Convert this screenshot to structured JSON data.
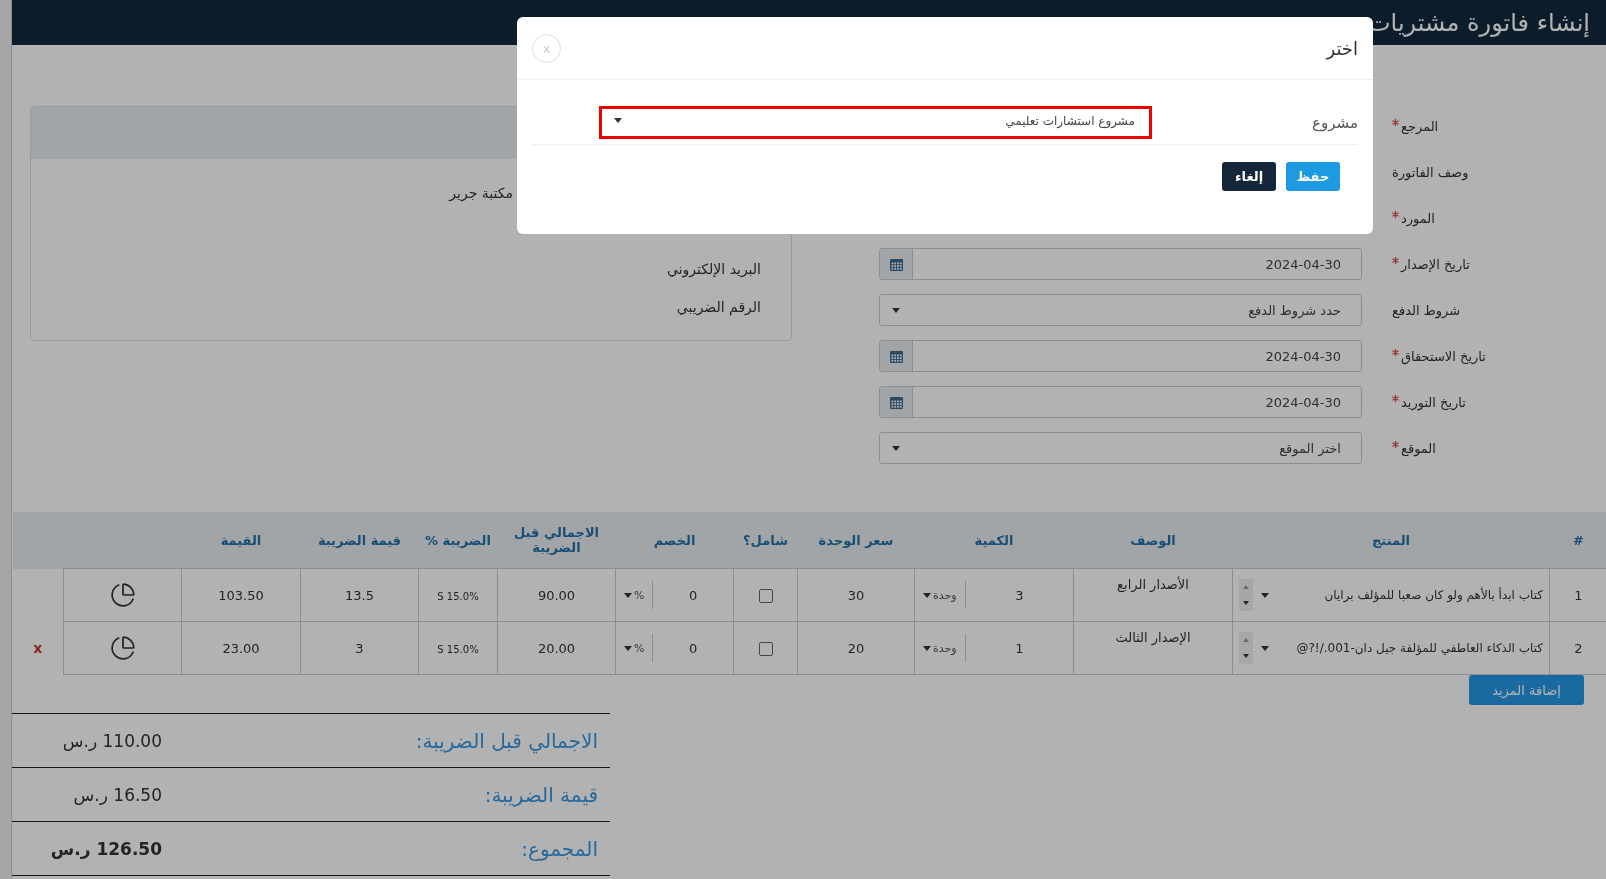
{
  "header": {
    "title": "إنشاء فاتورة مشتريات"
  },
  "supplier_card": {
    "name": "مكتبة جرير",
    "email_label": "البريد الإلكتروني",
    "tax_number_label": "الرقم الضريبي"
  },
  "form": {
    "fields": [
      {
        "label": "المرجع",
        "required": true,
        "kind": "text"
      },
      {
        "label": "وصف الفاتورة",
        "required": false,
        "kind": "text"
      },
      {
        "label": "المورد",
        "required": true,
        "kind": "text"
      },
      {
        "label": "تاريخ الإصدار",
        "required": true,
        "kind": "date",
        "value": "2024-04-30"
      },
      {
        "label": "شروط الدفع",
        "required": false,
        "kind": "select",
        "placeholder": "حدد شروط الدفع"
      },
      {
        "label": "تاريخ الاستحقاق",
        "required": true,
        "kind": "date",
        "value": "2024-04-30"
      },
      {
        "label": "تاريخ التوريد",
        "required": true,
        "kind": "date",
        "value": "2024-04-30"
      },
      {
        "label": "الموقع",
        "required": true,
        "kind": "select",
        "placeholder": "اختر الموقع"
      }
    ]
  },
  "table": {
    "columns": [
      "#",
      "المنتج",
      "الوصف",
      "الكمية",
      "سعر الوحدة",
      "شامل؟",
      "الخصم",
      "الاجمالي قبل الضريبة",
      "الضريبة %",
      "قيمة الضريبة",
      "القيمة"
    ],
    "rows": [
      {
        "number": "1",
        "product": "كتاب ابدأ بالأهم ولو كان صعبا للمؤلف برايان",
        "description": "الأصدار الرابع",
        "quantity": "3",
        "unit": "وحدة",
        "unit_price": "30",
        "inclusive": false,
        "discount": "0",
        "discount_type": "%",
        "pretax_total": "90.00",
        "tax": "S 15.0%",
        "tax_value": "13.5",
        "value": "103.50"
      },
      {
        "number": "2",
        "product": "كتاب الذكاء العاطفي للمؤلفة جيل دان-001./!?@",
        "description": "الإصدار الثالث",
        "quantity": "1",
        "unit": "وحدة",
        "unit_price": "20",
        "inclusive": false,
        "discount": "0",
        "discount_type": "%",
        "pretax_total": "20.00",
        "tax": "S 15.0%",
        "tax_value": "3",
        "value": "23.00",
        "delete": "x"
      }
    ]
  },
  "add_more_button": "إضافة المزيد",
  "totals": [
    {
      "label": "الاجمالي قبل الضريبة:",
      "amount": "110.00 ر.س",
      "bold": false
    },
    {
      "label": "قيمة الضريبة:",
      "amount": "16.50 ر.س",
      "bold": false
    },
    {
      "label": "المجموع:",
      "amount": "126.50 ر.س",
      "bold": true
    }
  ],
  "modal": {
    "title": "اختر",
    "close": "x",
    "field_label": "مشروع",
    "field_value": "مشروع استشارات تعليمي",
    "highlighted": true,
    "buttons": [
      {
        "label": "حفظ",
        "kind": "primary"
      },
      {
        "label": "إلغاء",
        "kind": "secondary"
      }
    ]
  }
}
